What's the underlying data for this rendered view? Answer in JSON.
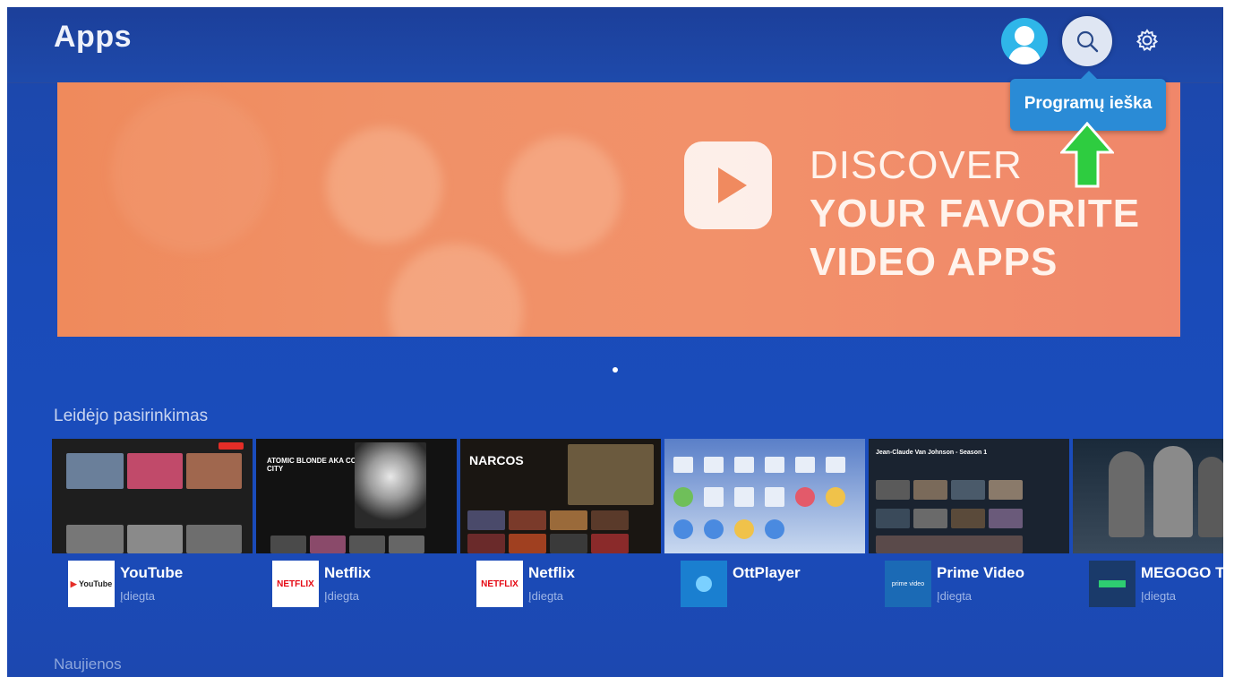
{
  "header": {
    "title": "Apps",
    "tooltip": "Programų ieška"
  },
  "banner": {
    "line1": "DISCOVER",
    "line2": "YOUR FAVORITE",
    "line3": "VIDEO APPS"
  },
  "sections": {
    "featured_title": "Leidėjo pasirinkimas",
    "news_title": "Naujienos"
  },
  "apps": [
    {
      "name": "YouTube",
      "status": "Įdiegta",
      "logo": "YouTube"
    },
    {
      "name": "Netflix",
      "status": "Įdiegta",
      "logo": "NETFLIX"
    },
    {
      "name": "Netflix",
      "status": "Įdiegta",
      "logo": "NETFLIX"
    },
    {
      "name": "OttPlayer",
      "status": "",
      "logo": ""
    },
    {
      "name": "Prime Video",
      "status": "Įdiegta",
      "logo": "prime video"
    },
    {
      "name": "MEGOGO TE",
      "status": "Įdiegta",
      "logo": ""
    }
  ],
  "thumb_texts": {
    "atomic": "ATOMIC BLONDE AKA COLDEST CITY",
    "narcos": "NARCOS",
    "prime": "Jean-Claude Van Johnson - Season 1"
  },
  "colors": {
    "background": "#1a4bb8",
    "tooltip": "#2a8bd6",
    "banner": "#f0906a",
    "arrow": "#2ecc40"
  },
  "icons": [
    "user-icon",
    "search-icon",
    "gear-icon",
    "play-icon",
    "arrow-up-icon"
  ]
}
